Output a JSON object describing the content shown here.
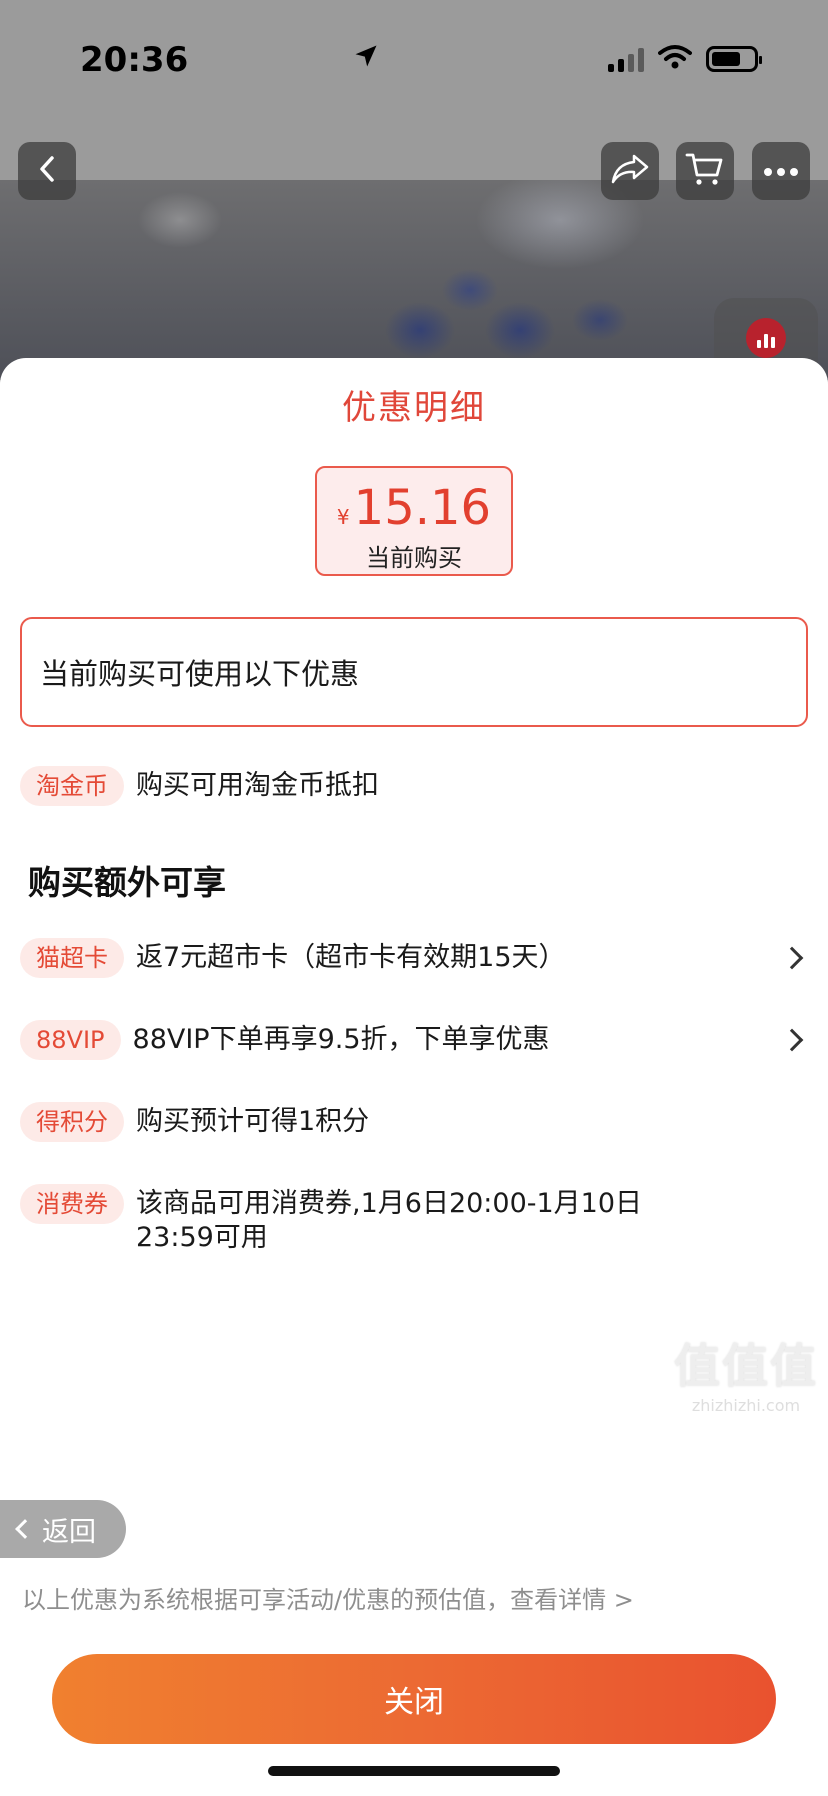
{
  "status_bar": {
    "time": "20:36"
  },
  "sheet": {
    "title": "优惠明细",
    "price": {
      "currency": "¥",
      "amount": "15.16",
      "caption": "当前购买"
    },
    "bubble_text": "当前购买可使用以下优惠",
    "coin_row": {
      "tag": "淘金币",
      "text": "购买可用淘金币抵扣"
    },
    "extra_section_title": "购买额外可享",
    "extra_items": [
      {
        "tag": "猫超卡",
        "text": "返7元超市卡（超市卡有效期15天）",
        "has_arrow": true
      },
      {
        "tag": "88VIP",
        "text": "88VIP下单再享9.5折，下单享优惠",
        "has_arrow": true
      },
      {
        "tag": "得积分",
        "text": "购买预计可得1积分",
        "has_arrow": false
      },
      {
        "tag": "消费券",
        "text": "该商品可用消费券,1月6日20:00-1月10日 23:59可用",
        "has_arrow": false
      }
    ],
    "back_label": "返回",
    "disclaimer": "以上优惠为系统根据可享活动/优惠的预估值，查看详情 >",
    "close_label": "关闭"
  },
  "watermark": {
    "big": "值值值",
    "small": "zhizhizhi.com"
  },
  "colors": {
    "accent": "#e2402f",
    "tag_bg": "#fdeae7",
    "button_gradient_start": "#f0802f",
    "button_gradient_end": "#e9522f"
  }
}
